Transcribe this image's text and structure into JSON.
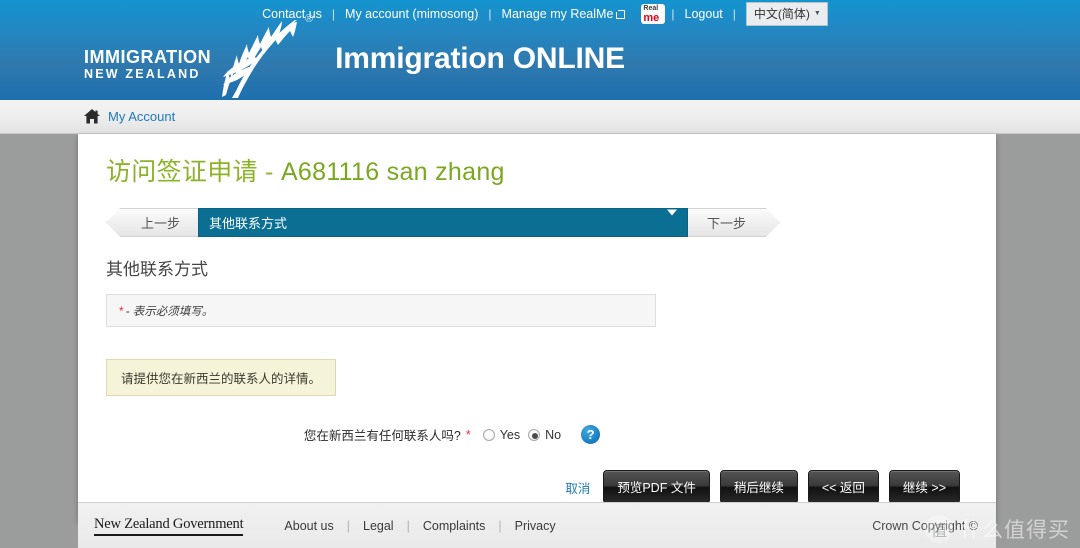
{
  "topnav": {
    "items": [
      {
        "label": "Contact us",
        "name": "contact-us"
      },
      {
        "label": "My account (mimosong)",
        "name": "my-account"
      },
      {
        "label": "Manage my RealMe",
        "name": "manage-realme"
      },
      {
        "label": "Logout",
        "name": "logout"
      }
    ],
    "separator": "|",
    "realme_logo": {
      "top": "Real",
      "bottom": "me"
    },
    "language": {
      "label": "中文(简体)",
      "caret": "▼"
    }
  },
  "brand": {
    "line1": "IMMIGRATION",
    "line2": "NEW ZEALAND",
    "registered": "®",
    "product_bold": "Immigration",
    "product_light": "ONLINE",
    "fern_icon": "silver-fern-icon"
  },
  "breadcrumb": {
    "home_icon": "home-icon",
    "label": "My Account"
  },
  "page": {
    "title_prefix": "访问签证申请",
    "title_sep": " - ",
    "title_app": "A681116 san zhang"
  },
  "stepper": {
    "prev_label": "上一步",
    "selected_section": "其他联系方式",
    "next_label": "下一步"
  },
  "section": {
    "heading": "其他联系方式",
    "required_star": "*",
    "required_note": "- 表示必须填写。",
    "info_text": "请提供您在新西兰的联系人的详情。"
  },
  "question": {
    "label": "您在新西兰有任何联系人吗?",
    "star": "*",
    "options": [
      {
        "label": "Yes",
        "value": "yes",
        "selected": false
      },
      {
        "label": "No",
        "value": "no",
        "selected": true
      }
    ],
    "help_icon": "help-question-icon",
    "help_glyph": "?"
  },
  "actions": {
    "cancel": "取消",
    "preview_pdf": "预览PDF 文件",
    "continue_later": "稍后继续",
    "back": "<< 返回",
    "next": "继续 >>"
  },
  "footer": {
    "govt": "New Zealand Government",
    "links": [
      {
        "label": "About us",
        "name": "about-us"
      },
      {
        "label": "Legal",
        "name": "legal"
      },
      {
        "label": "Complaints",
        "name": "complaints"
      },
      {
        "label": "Privacy",
        "name": "privacy"
      }
    ],
    "separator": "|",
    "copyright": "Crown Copyright ©"
  },
  "watermark": {
    "mark": "值",
    "text": "什么值得买"
  },
  "colors": {
    "header_top": "#1494cf",
    "header_bottom": "#1d6fae",
    "title_green": "#8cb329",
    "step_active": "#0b6e93",
    "link_blue": "#1d7bb9",
    "required_red": "#d33333",
    "info_yellow": "#f5f3d8",
    "button_dark": "#222222"
  }
}
